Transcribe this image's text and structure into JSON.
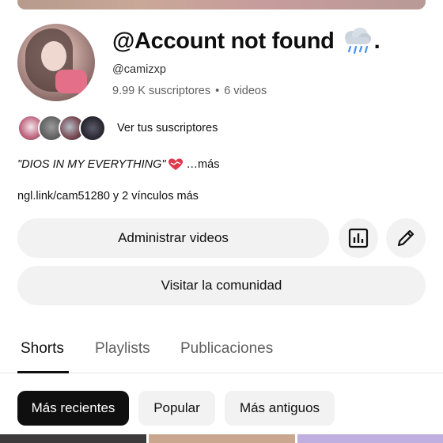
{
  "channel": {
    "name": "@Account not found",
    "name_suffix": ".",
    "name_emoji": "cloud-rain-emoji",
    "handle": "@camizxp",
    "subscribers": "9.99 K suscriptores",
    "videos": "6 videos",
    "stats_separator": "•"
  },
  "subscribers_preview": {
    "label": "Ver tus suscriptores"
  },
  "description": {
    "quote_text": "\"DIOS IN MY EVERYTHING\"",
    "emoji": "heart-emoji",
    "more": "…más"
  },
  "links": {
    "text": "ngl.link/cam51280 y 2 vínculos más"
  },
  "actions": {
    "manage_videos": "Administrar videos",
    "analytics_icon": "analytics-icon",
    "edit_icon": "pencil-icon",
    "visit_community": "Visitar la comunidad"
  },
  "tabs": [
    {
      "label": "Shorts",
      "active": true
    },
    {
      "label": "Playlists",
      "active": false
    },
    {
      "label": "Publicaciones",
      "active": false
    }
  ],
  "filters": [
    {
      "label": "Más recientes",
      "active": true
    },
    {
      "label": "Popular",
      "active": false
    },
    {
      "label": "Más antiguos",
      "active": false
    }
  ],
  "colors": {
    "text": "#0f0f0f",
    "secondary": "#606060",
    "button_bg": "#f2f2f2",
    "chip_active_bg": "#0f0f0f",
    "heart": "#e2384d"
  }
}
